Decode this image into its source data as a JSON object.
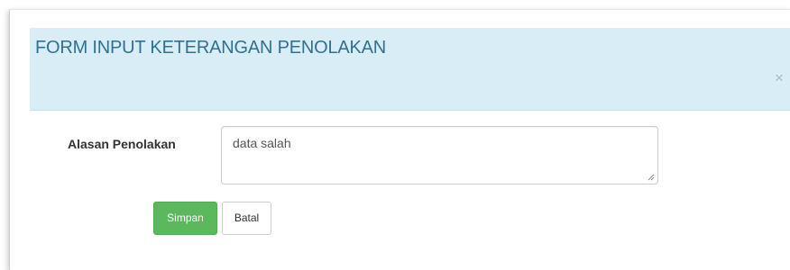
{
  "modal": {
    "title": "FORM INPUT KETERANGAN PENOLAKAN",
    "close_symbol": "×",
    "close_icon": "close-icon",
    "header_color": "#d9edf7",
    "title_color": "#31708f"
  },
  "form": {
    "reason_label": "Alasan Penolakan",
    "reason_value": "data salah"
  },
  "actions": {
    "save_label": "Simpan",
    "cancel_label": "Batal",
    "save_color": "#5cb85c"
  }
}
